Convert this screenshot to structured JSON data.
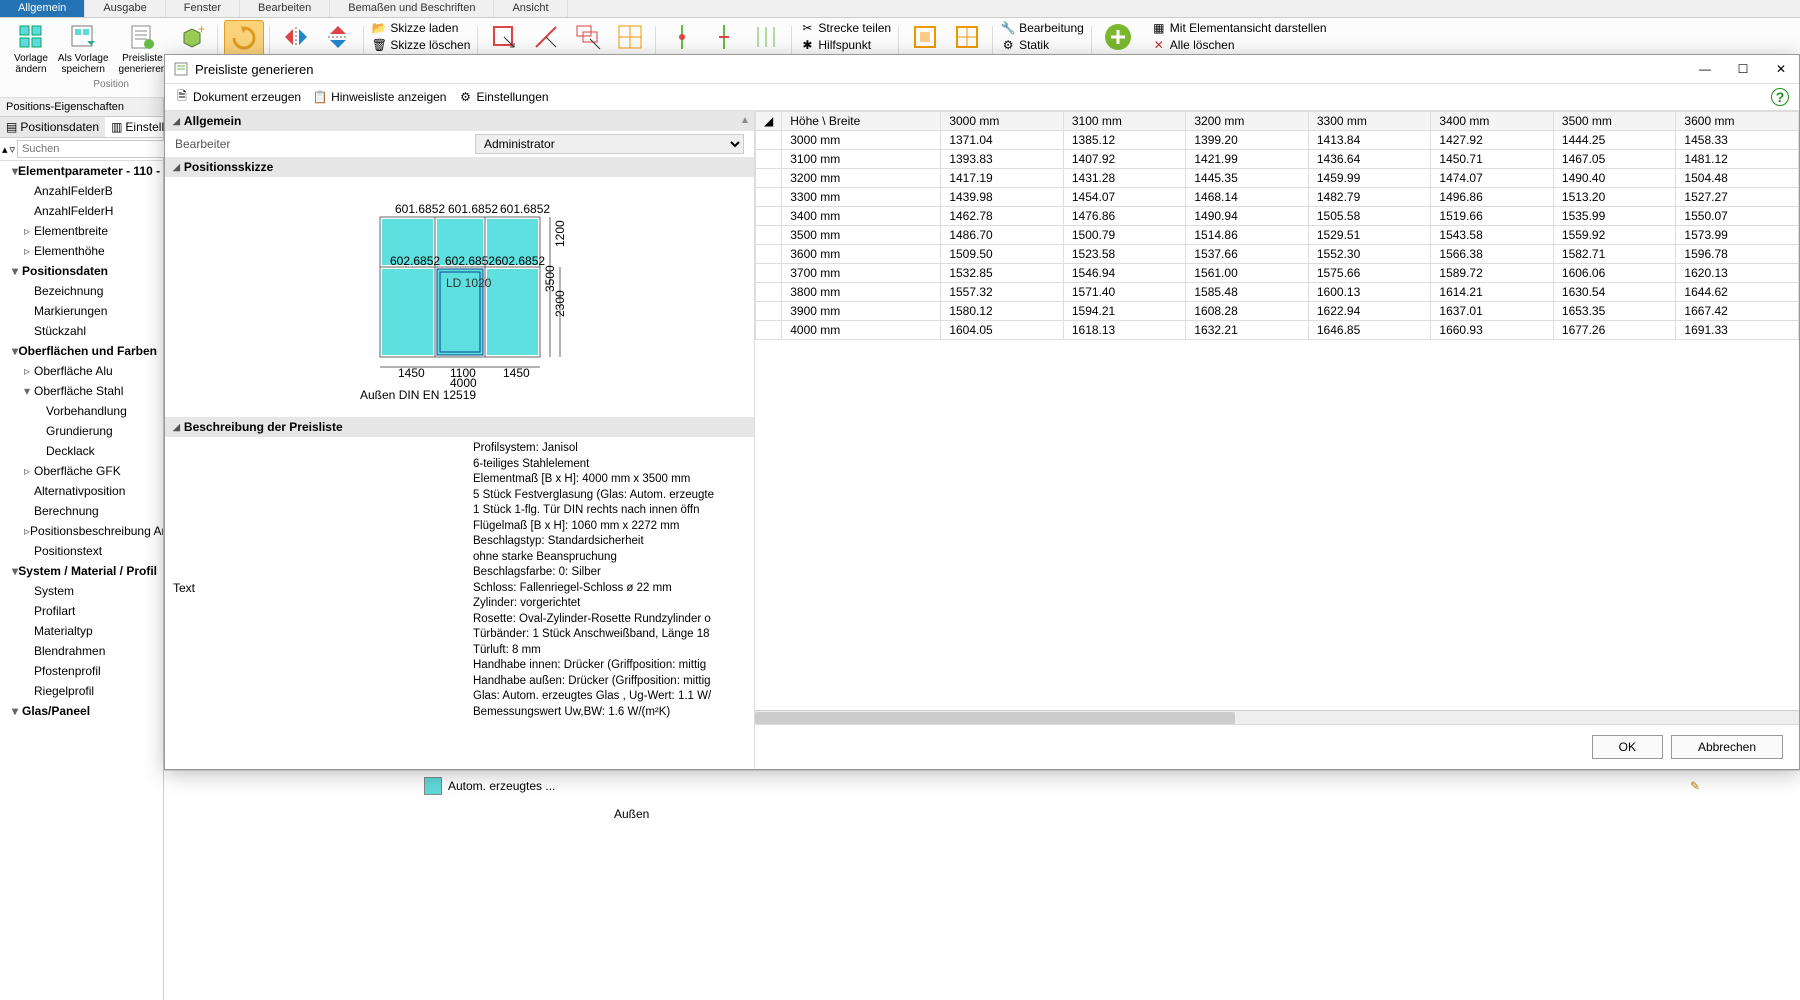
{
  "tabs": [
    "Allgemein",
    "Ausgabe",
    "Fenster",
    "Bearbeiten",
    "Bemaßen und Beschriften",
    "Ansicht"
  ],
  "active_tab_index": 0,
  "ribbon": {
    "position_group": "Position",
    "vorlage_aendern": "Vorlage\nändern",
    "als_vorlage_speichern": "Als Vorlage\nspeichern",
    "preisliste_generieren": "Preisliste\ngenerieren",
    "skizze_laden": "Skizze laden",
    "skizze_loeschen": "Skizze löschen",
    "strecke_teilen": "Strecke teilen",
    "hilfspunkt": "Hilfspunkt",
    "bearbeitung": "Bearbeitung",
    "statik": "Statik",
    "mit_elementansicht": "Mit Elementansicht darstellen",
    "alle_loeschen": "Alle löschen"
  },
  "leftpanel": {
    "header": "Positions-Eigenschaften",
    "subtab1": "Positionsdaten",
    "subtab2": "Einstellung",
    "search_placeholder": "Suchen",
    "tree": [
      {
        "d": 1,
        "exp": "▾",
        "t": "Elementparameter - 110 -"
      },
      {
        "d": 2,
        "exp": "",
        "t": "AnzahlFelderB"
      },
      {
        "d": 2,
        "exp": "",
        "t": "AnzahlFelderH"
      },
      {
        "d": 2,
        "exp": "▹",
        "t": "Elementbreite"
      },
      {
        "d": 2,
        "exp": "▹",
        "t": "Elementhöhe"
      },
      {
        "d": 1,
        "exp": "▾",
        "t": "Positionsdaten"
      },
      {
        "d": 2,
        "exp": "",
        "t": "Bezeichnung"
      },
      {
        "d": 2,
        "exp": "",
        "t": "Markierungen"
      },
      {
        "d": 2,
        "exp": "",
        "t": "Stückzahl"
      },
      {
        "d": 1,
        "exp": "▾",
        "t": "Oberflächen und Farben"
      },
      {
        "d": 2,
        "exp": "▹",
        "t": "Oberfläche Alu"
      },
      {
        "d": 2,
        "exp": "▾",
        "t": "Oberfläche Stahl"
      },
      {
        "d": 3,
        "exp": "",
        "t": "Vorbehandlung"
      },
      {
        "d": 3,
        "exp": "",
        "t": "Grundierung"
      },
      {
        "d": 3,
        "exp": "",
        "t": "Decklack"
      },
      {
        "d": 2,
        "exp": "▹",
        "t": "Oberfläche GFK"
      },
      {
        "d": 2,
        "exp": "",
        "t": "Alternativposition"
      },
      {
        "d": 2,
        "exp": "",
        "t": "Berechnung"
      },
      {
        "d": 2,
        "exp": "▹",
        "t": "Positionsbeschreibung Ang"
      },
      {
        "d": 2,
        "exp": "",
        "t": "Positionstext"
      },
      {
        "d": 1,
        "exp": "▾",
        "t": "System / Material / Profil"
      },
      {
        "d": 2,
        "exp": "",
        "t": "System"
      },
      {
        "d": 2,
        "exp": "",
        "t": "Profilart"
      },
      {
        "d": 2,
        "exp": "",
        "t": "Materialtyp"
      },
      {
        "d": 2,
        "exp": "",
        "t": "Blendrahmen"
      },
      {
        "d": 2,
        "exp": "",
        "t": "Pfostenprofil"
      },
      {
        "d": 2,
        "exp": "",
        "t": "Riegelprofil"
      },
      {
        "d": 1,
        "exp": "▾",
        "t": "Glas/Paneel"
      }
    ]
  },
  "modal": {
    "title": "Preisliste generieren",
    "tb_dokument": "Dokument erzeugen",
    "tb_hinweis": "Hinweisliste anzeigen",
    "tb_einst": "Einstellungen",
    "sec_allgemein": "Allgemein",
    "bearbeiter_k": "Bearbeiter",
    "bearbeiter_v": "Administrator",
    "sec_skizze": "Positionsskizze",
    "sec_beschreibung": "Beschreibung der Preisliste",
    "desc_k": "Text",
    "desc_v": "Profilsystem: Janisol\n6-teiliges Stahlelement\nElementmaß [B x H]: 4000 mm x 3500 mm\n5 Stück Festverglasung (Glas: Autom. erzeugte\n1 Stück 1-flg. Tür DIN rechts    nach innen öffn\nFlügelmaß [B x H]: 1060 mm x 2272 mm\nBeschlagstyp: Standardsicherheit\nohne starke Beanspruchung\nBeschlagsfarbe: 0: Silber\nSchloss: Fallenriegel-Schloss ø 22 mm\nZylinder: vorgerichtet\nRosette: Oval-Zylinder-Rosette Rundzylinder o\nTürbänder: 1 Stück Anschweißband, Länge 18\nTürluft: 8 mm\nHandhabe innen: Drücker (Griffposition: mittig\nHandhabe außen: Drücker (Griffposition: mittig\nGlas: Autom. erzeugtes Glas , Ug-Wert: 1.1 W/\nBemessungswert Uw,BW: 1.6 W/(m²K)",
    "hx_label": "Höhe \\ Breite",
    "columns": [
      "3000 mm",
      "3100 mm",
      "3200 mm",
      "3300 mm",
      "3400 mm",
      "3500 mm",
      "3600 mm"
    ],
    "rows": [
      {
        "h": "3000 mm",
        "v": [
          "1371.04",
          "1385.12",
          "1399.20",
          "1413.84",
          "1427.92",
          "1444.25",
          "1458.33"
        ]
      },
      {
        "h": "3100 mm",
        "v": [
          "1393.83",
          "1407.92",
          "1421.99",
          "1436.64",
          "1450.71",
          "1467.05",
          "1481.12"
        ]
      },
      {
        "h": "3200 mm",
        "v": [
          "1417.19",
          "1431.28",
          "1445.35",
          "1459.99",
          "1474.07",
          "1490.40",
          "1504.48"
        ]
      },
      {
        "h": "3300 mm",
        "v": [
          "1439.98",
          "1454.07",
          "1468.14",
          "1482.79",
          "1496.86",
          "1513.20",
          "1527.27"
        ]
      },
      {
        "h": "3400 mm",
        "v": [
          "1462.78",
          "1476.86",
          "1490.94",
          "1505.58",
          "1519.66",
          "1535.99",
          "1550.07"
        ]
      },
      {
        "h": "3500 mm",
        "v": [
          "1486.70",
          "1500.79",
          "1514.86",
          "1529.51",
          "1543.58",
          "1559.92",
          "1573.99"
        ]
      },
      {
        "h": "3600 mm",
        "v": [
          "1509.50",
          "1523.58",
          "1537.66",
          "1552.30",
          "1566.38",
          "1582.71",
          "1596.78"
        ]
      },
      {
        "h": "3700 mm",
        "v": [
          "1532.85",
          "1546.94",
          "1561.00",
          "1575.66",
          "1589.72",
          "1606.06",
          "1620.13"
        ]
      },
      {
        "h": "3800 mm",
        "v": [
          "1557.32",
          "1571.40",
          "1585.48",
          "1600.13",
          "1614.21",
          "1630.54",
          "1644.62"
        ]
      },
      {
        "h": "3900 mm",
        "v": [
          "1580.12",
          "1594.21",
          "1608.28",
          "1622.94",
          "1637.01",
          "1653.35",
          "1667.42"
        ]
      },
      {
        "h": "4000 mm",
        "v": [
          "1604.05",
          "1618.13",
          "1632.21",
          "1646.85",
          "1660.93",
          "1677.26",
          "1691.33"
        ]
      }
    ],
    "ok": "OK",
    "cancel": "Abbrechen"
  },
  "footer": {
    "autom": "Autom. erzeugtes ...",
    "aussen": "Außen"
  },
  "sketch": {
    "top_dim": "601.6852",
    "side_h": "3500",
    "side_h2": "2300",
    "side_h3": "1200",
    "bottom_1": "1450",
    "bottom_2": "1100",
    "bottom_3": "1450",
    "bottom_total": "4000",
    "door": "LD 1020",
    "note": "Außen\nDIN EN 12519",
    "cell": "602.6852"
  }
}
